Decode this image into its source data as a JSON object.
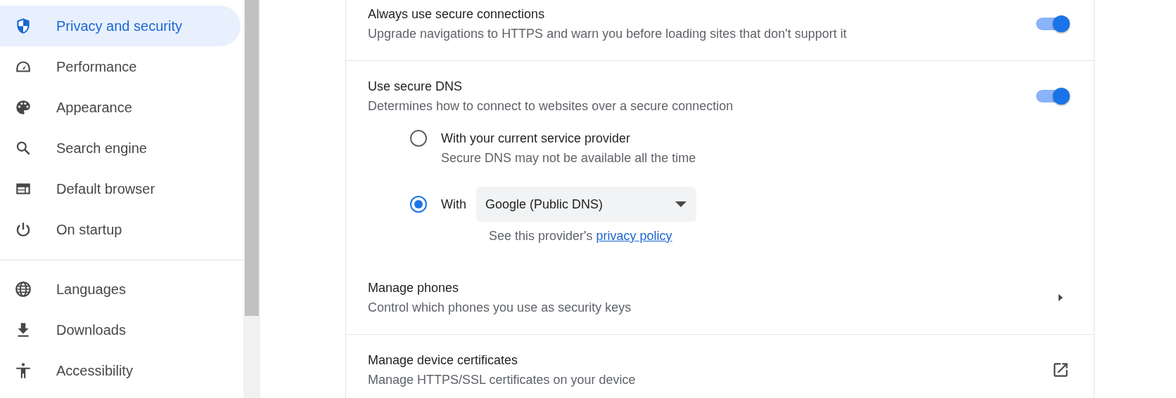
{
  "sidebar": {
    "groups": [
      {
        "items": [
          {
            "label": "Privacy and security",
            "selected": true
          },
          {
            "label": "Performance",
            "selected": false
          },
          {
            "label": "Appearance",
            "selected": false
          },
          {
            "label": "Search engine",
            "selected": false
          },
          {
            "label": "Default browser",
            "selected": false
          },
          {
            "label": "On startup",
            "selected": false
          }
        ]
      },
      {
        "items": [
          {
            "label": "Languages",
            "selected": false
          },
          {
            "label": "Downloads",
            "selected": false
          },
          {
            "label": "Accessibility",
            "selected": false
          }
        ]
      }
    ]
  },
  "settings": [
    {
      "kind": "toggle",
      "title": "Always use secure connections",
      "description": "Upgrade navigations to HTTPS and warn you before loading sites that don't support it",
      "on": true
    },
    {
      "kind": "toggle",
      "title": "Use secure DNS",
      "description": "Determines how to connect to websites over a secure connection",
      "on": true,
      "options": [
        {
          "label": "With your current service provider",
          "description": "Secure DNS may not be available all the time",
          "selected": false
        },
        {
          "label": "With",
          "selected": true,
          "dropdown": {
            "value": "Google (Public DNS)"
          },
          "note": {
            "text": "See this provider's",
            "link": "privacy policy"
          }
        }
      ]
    },
    {
      "kind": "subpage",
      "title": "Manage phones",
      "description": "Control which phones you use as security keys"
    },
    {
      "kind": "external",
      "title": "Manage device certificates",
      "description": "Manage HTTPS/SSL certificates on your device"
    }
  ]
}
